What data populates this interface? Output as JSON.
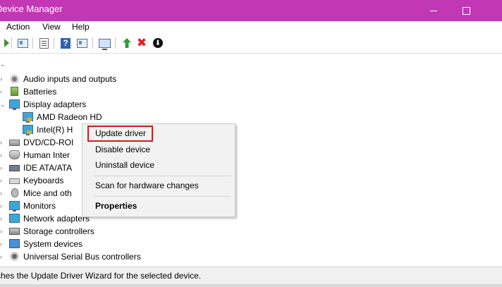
{
  "window": {
    "title": "Device Manager"
  },
  "menu": {
    "items": [
      "Action",
      "View",
      "Help"
    ]
  },
  "toolbar": {
    "icons": [
      "forward-icon",
      "show-hide-console-tree-icon",
      "properties-icon",
      "help-icon",
      "display-icon",
      "monitor-icon",
      "enable-device-icon",
      "uninstall-device-icon",
      "update-driver-icon"
    ]
  },
  "tree": {
    "categories": [
      {
        "label": "Audio inputs and outputs",
        "expanded": false
      },
      {
        "label": "Batteries",
        "expanded": false
      },
      {
        "label": "Display adapters",
        "expanded": true,
        "children": [
          "AMD Radeon HD",
          "Intel(R) H"
        ]
      },
      {
        "label": "DVD/CD-ROI",
        "expanded": false
      },
      {
        "label": "Human Inter",
        "expanded": false
      },
      {
        "label": "IDE ATA/ATA",
        "expanded": false
      },
      {
        "label": "Keyboards",
        "expanded": false
      },
      {
        "label": "Mice and oth",
        "expanded": false
      },
      {
        "label": "Monitors",
        "expanded": false
      },
      {
        "label": "Network adapters",
        "expanded": false
      },
      {
        "label": "Storage controllers",
        "expanded": false
      },
      {
        "label": "System devices",
        "expanded": false
      },
      {
        "label": "Universal Serial Bus controllers",
        "expanded": false
      }
    ]
  },
  "context_menu": {
    "items": [
      "Update driver",
      "Disable device",
      "Uninstall device",
      "Scan for hardware changes",
      "Properties"
    ],
    "highlighted": "Update driver"
  },
  "status": {
    "text": "ches the Update Driver Wizard for the selected device."
  },
  "colors": {
    "titlebar": "#c238b4",
    "highlight_border": "#d11c1c"
  }
}
